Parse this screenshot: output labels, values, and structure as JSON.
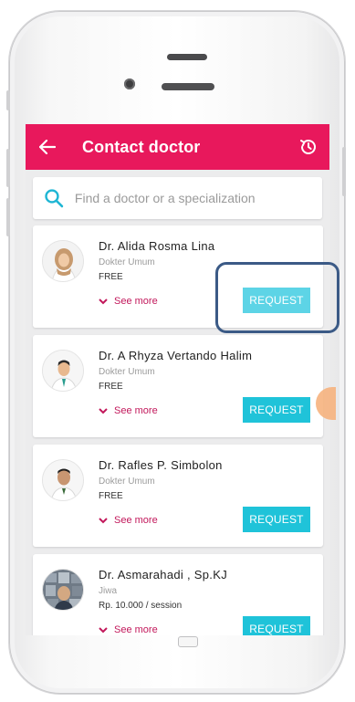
{
  "app": {
    "title": "Contact doctor",
    "accent_color": "#e8185c",
    "button_color": "#1fc3d9"
  },
  "search": {
    "placeholder": "Find a doctor or a specialization"
  },
  "doctors": [
    {
      "name": "Dr. Alida Rosma Lina",
      "specialty": "Dokter Umum",
      "price": "FREE",
      "see_more": "See more",
      "action": "REQUEST",
      "avatar": "female-doctor-hijab"
    },
    {
      "name": "Dr. A Rhyza Vertando Halim",
      "specialty": "Dokter Umum",
      "price": "FREE",
      "see_more": "See more",
      "action": "REQUEST",
      "avatar": "male-doctor-coat"
    },
    {
      "name": "Dr. Rafles P. Simbolon",
      "specialty": "Dokter Umum",
      "price": "FREE",
      "see_more": "See more",
      "action": "REQUEST",
      "avatar": "male-doctor-coat"
    },
    {
      "name": "Dr. Asmarahadi , Sp.KJ",
      "specialty": "Jiwa",
      "price": "Rp. 10.000 / session",
      "see_more": "See more",
      "action": "REQUEST",
      "avatar": "doctor-photo-wall"
    }
  ],
  "icons": {
    "back": "arrow-left-icon",
    "history": "history-icon",
    "search": "search-icon",
    "see_more": "chevron-down-icon"
  }
}
